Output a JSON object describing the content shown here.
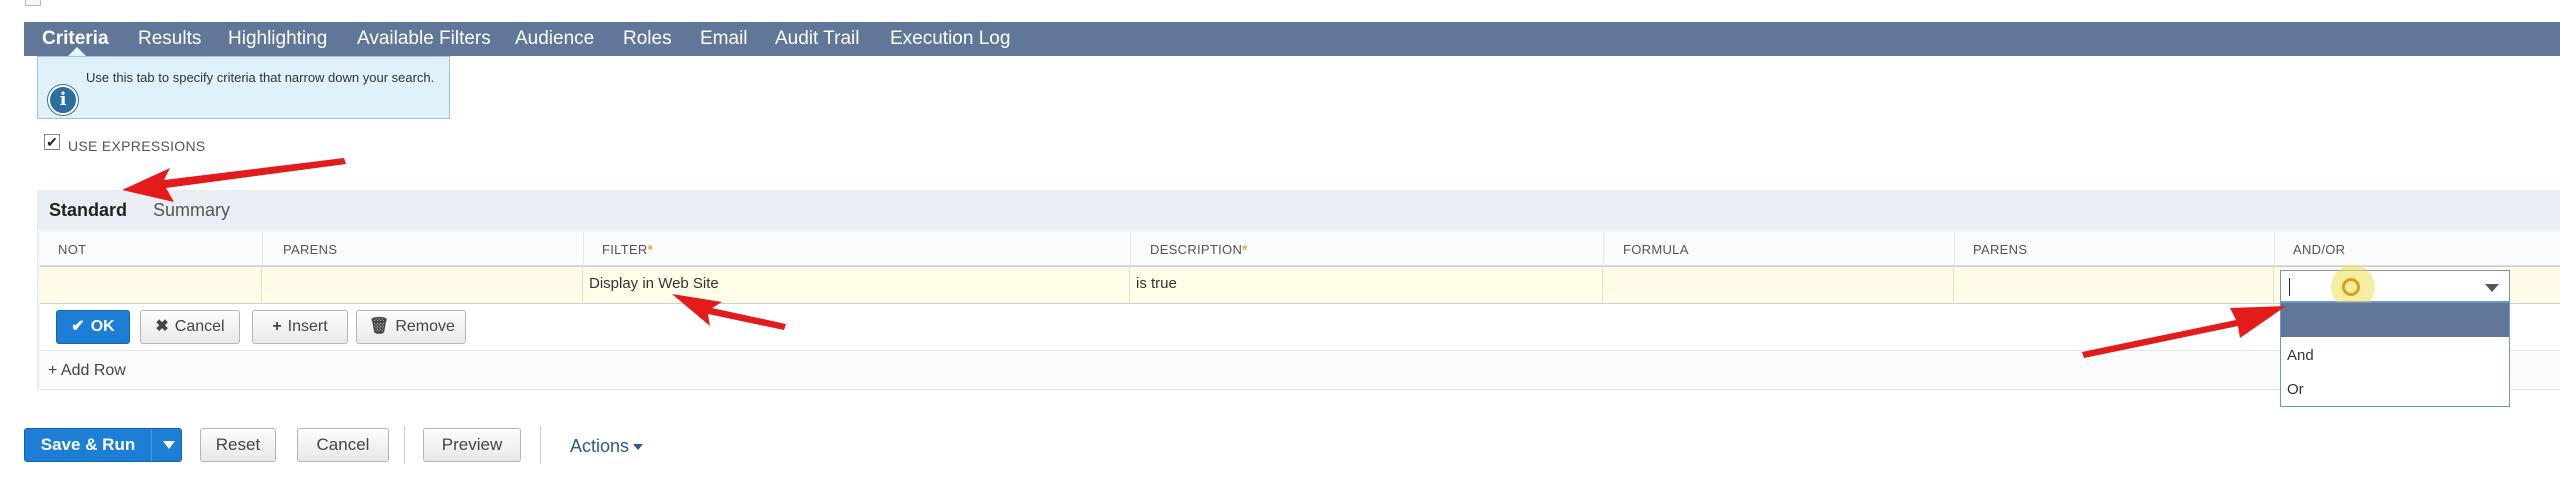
{
  "tabs": [
    {
      "label": "Criteria",
      "active": true
    },
    {
      "label": "Results"
    },
    {
      "label": "Highlighting"
    },
    {
      "label": "Available Filters"
    },
    {
      "label": "Audience"
    },
    {
      "label": "Roles"
    },
    {
      "label": "Email"
    },
    {
      "label": "Audit Trail"
    },
    {
      "label": "Execution Log"
    }
  ],
  "help": {
    "text": "Use this tab to specify criteria that narrow down your search.",
    "icon": "info-icon"
  },
  "use_expressions": {
    "label": "USE EXPRESSIONS",
    "checked": true
  },
  "subtabs": [
    {
      "label": "Standard",
      "active": true
    },
    {
      "label": "Summary"
    }
  ],
  "columns": {
    "not": "NOT",
    "parens_open": "PARENS",
    "filter": "FILTER",
    "description": "DESCRIPTION",
    "formula": "FORMULA",
    "parens_close": "PARENS",
    "and_or": "AND/OR",
    "required_marker": "*"
  },
  "row": {
    "filter": "Display in Web Site",
    "description": "is true"
  },
  "row_buttons": {
    "ok": "OK",
    "cancel": "Cancel",
    "insert": "Insert",
    "remove": "Remove"
  },
  "add_row": "Add Row",
  "and_or_dropdown": {
    "value": "",
    "options": [
      "",
      "And",
      "Or"
    ]
  },
  "footer": {
    "save_run": "Save & Run",
    "reset": "Reset",
    "cancel": "Cancel",
    "preview": "Preview",
    "actions": "Actions"
  },
  "colors": {
    "tabbar": "#607799",
    "primary": "#1d7ed6",
    "annotation_arrow": "#e31b1b"
  }
}
